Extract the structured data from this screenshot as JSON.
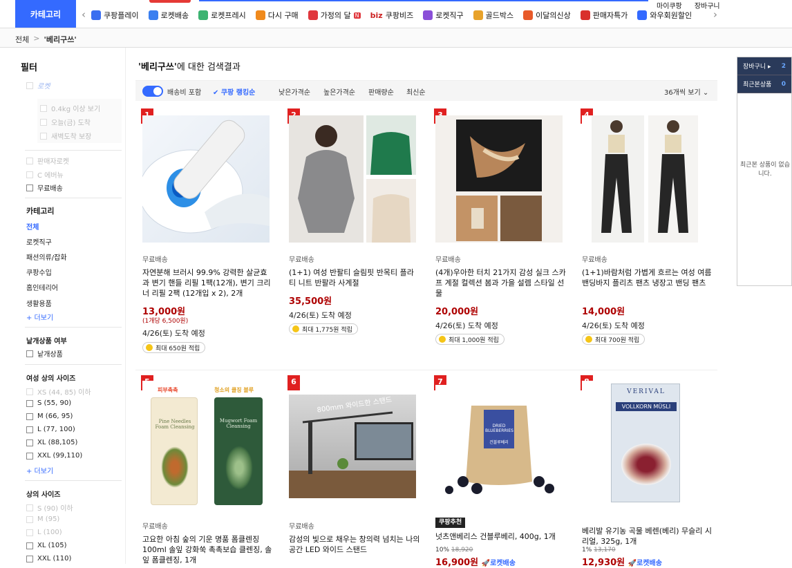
{
  "header": {
    "category_label": "카테고리",
    "my_coupang": "마이쿠팡",
    "cart": "장바구니",
    "nav": [
      {
        "label": "쿠팡플레이",
        "color": "#3a6ef0"
      },
      {
        "label": "로켓배송",
        "color": "#3a7ff0"
      },
      {
        "label": "로켓프레시",
        "color": "#3cb371"
      },
      {
        "label": "다시 구매",
        "color": "#f08a1c"
      },
      {
        "label": "가정의 달",
        "color": "#e0383e",
        "badge": "N"
      },
      {
        "label": "쿠팡비즈",
        "prefix": "biz",
        "color": "#cc2222"
      },
      {
        "label": "로켓직구",
        "color": "#8a4fd8"
      },
      {
        "label": "골드박스",
        "color": "#e8a22a"
      },
      {
        "label": "이달의신상",
        "color": "#e85a2a"
      },
      {
        "label": "판매자특가",
        "color": "#d9302c"
      },
      {
        "label": "와우회원할인",
        "color": "#346aff"
      }
    ]
  },
  "breadcrumb": {
    "root": "전체",
    "separator": ">",
    "current": "'베리구쓰'"
  },
  "sidebar": {
    "filter_title": "필터",
    "top_options": [
      "로켓",
      "0.4kg 이상 보기",
      "오늘(금) 도착",
      "새벽도착 보장"
    ],
    "delivery_options": [
      "판매자로켓",
      "C 에버뉴",
      "무료배송"
    ],
    "category_title": "카테고리",
    "categories": [
      "전체",
      "로켓직구",
      "패션의류/잡화",
      "쿠팡수입",
      "홈인테리어",
      "생활용품"
    ],
    "more": "+ 더보기",
    "single_title": "낱개상품 여부",
    "single_option": "낱개상품",
    "women_size_title": "여성 상의 사이즈",
    "women_sizes": [
      "XS (44, 85) 이하",
      "S (55, 90)",
      "M (66, 95)",
      "L (77, 100)",
      "XL (88,105)",
      "XXL (99,110)"
    ],
    "top_size_title": "상의 사이즈",
    "top_sizes": [
      "S (90) 이하",
      "M (95)",
      "L (100)",
      "XL (105)",
      "XXL (110)"
    ]
  },
  "main": {
    "result_title_prefix": "'베리구쓰'",
    "result_title_suffix": "에 대한 검색결과",
    "sort": {
      "ship_toggle": "배송비 포함",
      "ranking": "✔ 쿠팡 랭킹순",
      "low": "낮은가격순",
      "high": "높은가격순",
      "sales": "판매량순",
      "new": "최신순",
      "view_count": "36개씩 보기"
    },
    "products": [
      {
        "rank": "1",
        "ship": "무료배송",
        "name": "자연분해 브러시 99.9% 강력한 살균효과 변기 핸들 리필 1팩(12개), 변기 크리너 리필 2팩 (12개입 x 2), 2개",
        "price": "13,000원",
        "unit": "(1개당 6,500원)",
        "arrival": "4/26(토) 도착 예정",
        "points": "최대 650원 적립"
      },
      {
        "rank": "2",
        "ship": "무료배송",
        "name": "(1+1) 여성 반팔티 슬림핏 반목티 플라티 니트 반팔라 사계절",
        "price": "35,500원",
        "arrival": "4/26(토) 도착 예정",
        "points": "최대 1,775원 적립"
      },
      {
        "rank": "3",
        "ship": "무료배송",
        "name": "(4개)우아한 터치 21가지 감성 실크 스카프 계절 컬렉션 봄과 가을 설렘 스타일 선물",
        "price": "20,000원",
        "arrival": "4/26(토) 도착 예정",
        "points": "최대 1,000원 적립"
      },
      {
        "rank": "4",
        "ship": "무료배송",
        "name": "(1+1)바람처럼 가볍게 흐르는 여성 여름밴딩바지 플리츠 팬츠 냉장고 밴딩 팬츠",
        "price": "14,000원",
        "arrival": "4/26(토) 도착 예정",
        "points": "최대 700원 적립"
      },
      {
        "rank": "5",
        "ship": "무료배송",
        "name": "고요한 아침 숲의 기운 명품 폼클렌징 100ml 솔잎 강화쑥 촉촉보습 클렌징, 솔잎 폼클렌징, 1개",
        "img_label_a": "피부촉촉",
        "img_label_b": "청소의 클징 블루",
        "tube_a": "Pine Needles Foam Cleansing",
        "tube_b": "Mugwort Foam Cleansing"
      },
      {
        "rank": "6",
        "ship": "무료배송",
        "name": "감성의 빛으로 채우는 창의력 넘치는 나의 공간 LED 와이드 스탠드",
        "img_label": "800mm 와이드한 스탠드"
      },
      {
        "rank": "7",
        "badge": "쿠팡추천",
        "name": "넛츠앤베리스 건블루베리, 400g, 1개",
        "discount": "10%",
        "orig": "18,920",
        "price": "16,900원",
        "rocket": "로켓배송",
        "bag_label": "DRIED BLUEBERRIES",
        "bag_kr": "건블루베리"
      },
      {
        "rank": "8",
        "name": "베리발 유기농 곡물 베렌(베리) 무슬리 시리얼, 325g, 1개",
        "discount": "1%",
        "orig": "13,170",
        "price": "12,930원",
        "rocket": "로켓배송",
        "box_brand": "VERIVAL",
        "box_name": "VOLLKORN MÜSLI"
      }
    ]
  },
  "rightbar": {
    "cart_label": "장바구니 ▸",
    "cart_count": "2",
    "recent_label": "최근본상품",
    "recent_count": "0",
    "empty_text": "최근본 상품이 없습니다."
  }
}
